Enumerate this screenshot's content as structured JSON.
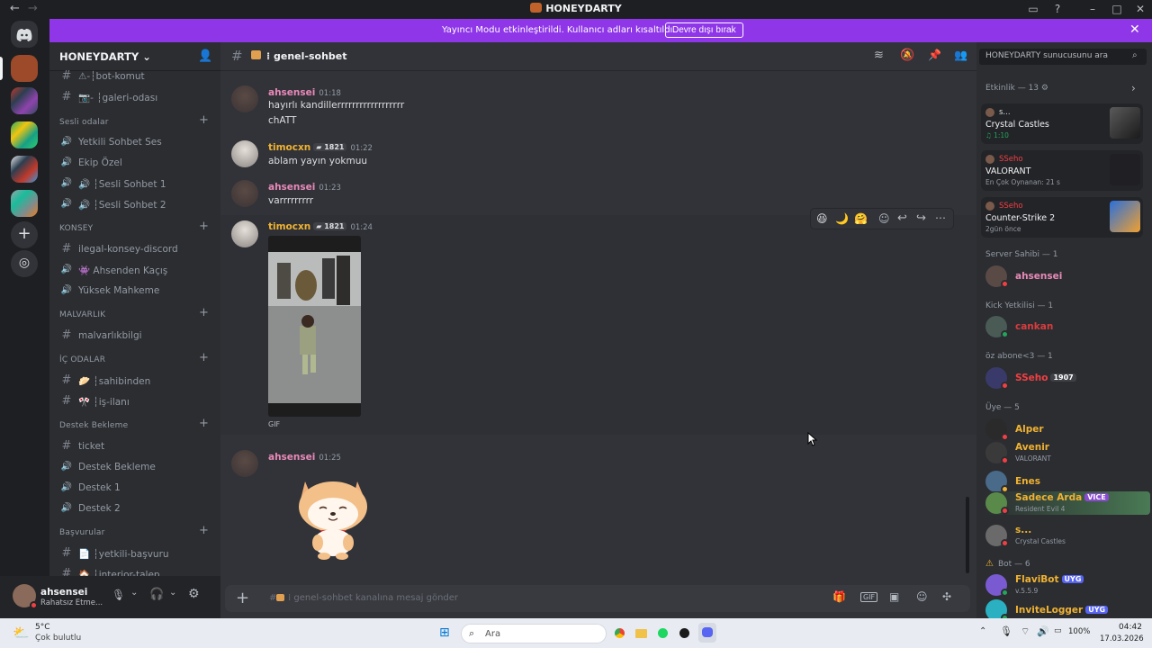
{
  "window": {
    "title": "HONEYDARTY"
  },
  "banner": {
    "text": "Yayıncı Modu etkinleştirildi. Kullanıcı adları kısaltıldı.",
    "button": "Devre dışı bırak"
  },
  "sidebar": {
    "server_name": "HONEYDARTY",
    "channels": [
      {
        "icon": "#",
        "label": "⚠-┆bot-komut",
        "kind": "text"
      },
      {
        "icon": "#",
        "label": "📷- ┆galeri-odası",
        "kind": "text"
      },
      {
        "category": "Sesli odalar"
      },
      {
        "icon": "🔊",
        "label": "Yetkili Sohbet Ses",
        "kind": "voice-locked"
      },
      {
        "icon": "🔊",
        "label": "Ekip Özel",
        "kind": "voice-locked"
      },
      {
        "icon": "🔊",
        "label": "🔊 ┆Sesli Sohbet 1",
        "kind": "voice"
      },
      {
        "icon": "🔊",
        "label": "🔊 ┆Sesli Sohbet 2",
        "kind": "voice"
      },
      {
        "category": "KONSEY"
      },
      {
        "icon": "#",
        "label": "ilegal-konsey-discord",
        "kind": "text"
      },
      {
        "icon": "🔊",
        "label": "👾 Ahsenden Kaçış",
        "kind": "voice"
      },
      {
        "icon": "🔊",
        "label": "Yüksek Mahkeme",
        "kind": "voice"
      },
      {
        "category": "MALVARLIK"
      },
      {
        "icon": "#",
        "label": "malvarlıkbilgi",
        "kind": "text"
      },
      {
        "category": "İÇ ODALAR"
      },
      {
        "icon": "#",
        "label": "🥟 ┆sahibinden",
        "kind": "text"
      },
      {
        "icon": "#",
        "label": "🎌 ┆iş-ilanı",
        "kind": "text"
      },
      {
        "category": "Destek Bekleme"
      },
      {
        "icon": "#",
        "label": "ticket",
        "kind": "text"
      },
      {
        "icon": "🔊",
        "label": "Destek Bekleme",
        "kind": "voice-locked"
      },
      {
        "icon": "🔊",
        "label": "Destek 1",
        "kind": "voice-locked"
      },
      {
        "icon": "🔊",
        "label": "Destek 2",
        "kind": "voice-locked"
      },
      {
        "category": "Başvurular"
      },
      {
        "icon": "#",
        "label": "📄 ┆yetkili-başvuru",
        "kind": "text"
      },
      {
        "icon": "#",
        "label": "🏠 ┆interior-talep",
        "kind": "text"
      }
    ]
  },
  "user": {
    "name": "ahsensei",
    "status": "Rahatsız Etme..."
  },
  "chat": {
    "channel": "⁞ genel-sohbet",
    "messages": [
      {
        "author": "ahsensei",
        "time": "01:18",
        "color": "#e889b8",
        "lines": [
          "hayırlı kandillerrrrrrrrrrrrrrrrrr",
          "chATT"
        ]
      },
      {
        "author": "timocxn",
        "tag": "1821",
        "time": "01:22",
        "color": "#f0b232",
        "lines": [
          "ablam yayın yokmuu"
        ]
      },
      {
        "author": "ahsensei",
        "time": "01:23",
        "color": "#e889b8",
        "lines": [
          "varrrrrrrrr"
        ]
      },
      {
        "author": "timocxn",
        "tag": "1821",
        "time": "01:24",
        "color": "#f0b232",
        "lines": [],
        "attachment": "GIF"
      },
      {
        "author": "ahsensei",
        "time": "01:25",
        "color": "#e889b8",
        "lines": [],
        "sticker": "shiba"
      }
    ],
    "composer_placeholder": "⁞ genel-sohbet kanalına mesaj gönder"
  },
  "search": {
    "placeholder": "HONEYDARTY sunucusunu ara"
  },
  "members": {
    "activity_header": "Etkinlik — 13",
    "activities": [
      {
        "name": "s...",
        "game": "Crystal Castles",
        "sub": "♫ 1:10",
        "name_color": "#dbdee1"
      },
      {
        "name": "SSeho",
        "game": "VALORANT",
        "sub": "En Çok Oynanan: 21 s",
        "name_color": "#f23f43"
      },
      {
        "name": "SSeho",
        "game": "Counter-Strike 2",
        "sub": "2gün önce",
        "name_color": "#f23f43"
      }
    ],
    "groups": [
      {
        "title": "Server Sahibi — 1",
        "members": [
          {
            "name": "ahsensei",
            "color": "#e889b8",
            "sub": ""
          }
        ]
      },
      {
        "title": "Kick Yetkilisi — 1",
        "members": [
          {
            "name": "cankan",
            "color": "#d83c3e",
            "sub": ""
          }
        ]
      },
      {
        "title": "öz abone<3 — 1",
        "members": [
          {
            "name": "SSeho",
            "color": "#f23f43",
            "sub": "",
            "tag": "1907"
          }
        ]
      },
      {
        "title": "Üye — 5",
        "members": [
          {
            "name": "Alper",
            "color": "#f0b232",
            "sub": ""
          },
          {
            "name": "Avenir",
            "color": "#f0b232",
            "sub": "VALORANT"
          },
          {
            "name": "Enes",
            "color": "#f0b232",
            "sub": ""
          },
          {
            "name": "Sadece Arda",
            "color": "#f0b232",
            "sub": "Resident Evil 4",
            "tag": "VICE"
          },
          {
            "name": "s...",
            "color": "#f0b232",
            "sub": "Crystal Castles"
          }
        ]
      },
      {
        "title": "Bot — 6",
        "members": [
          {
            "name": "FlaviBot",
            "color": "#f0b232",
            "sub": "v.5.5.9",
            "tag": "UYG"
          },
          {
            "name": "InviteLogger",
            "color": "#f0b232",
            "sub": "",
            "tag": "UYG"
          }
        ]
      }
    ]
  },
  "taskbar": {
    "weather_temp": "5°C",
    "weather_desc": "Çok bulutlu",
    "search": "Ara",
    "battery": "100%",
    "time": "04:42",
    "date": "17.03.2026"
  }
}
